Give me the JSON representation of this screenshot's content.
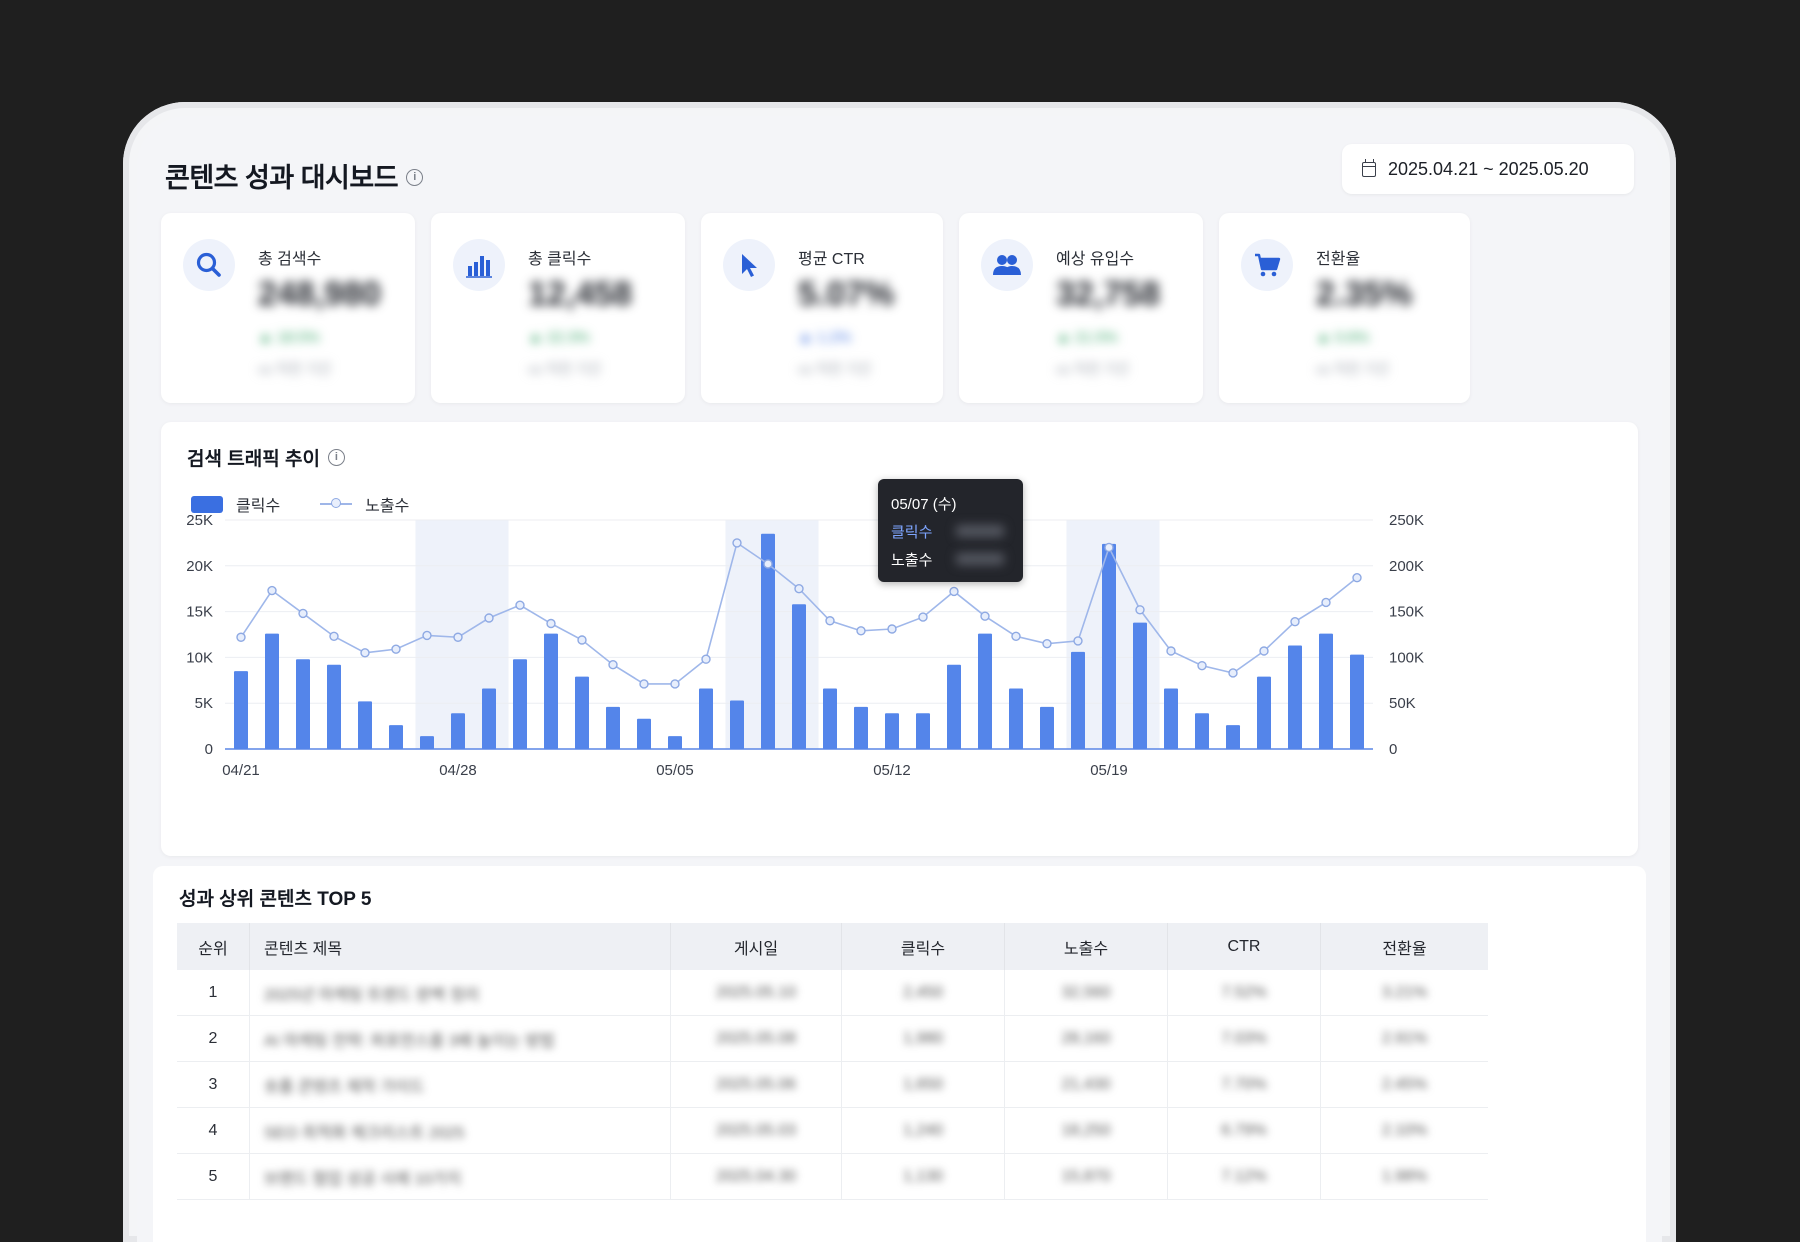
{
  "header": {
    "title": "콘텐츠 성과 대시보드",
    "date_range": "2025.04.21 ~ 2025.05.20"
  },
  "kpis": [
    {
      "label": "총 검색수",
      "icon": "search-icon",
      "value": "248,980",
      "delta": "▲ 18.5%",
      "sub": "vs 직전 기간"
    },
    {
      "label": "총 클릭수",
      "icon": "bar-chart-icon",
      "value": "12,458",
      "delta": "▲ 22.3%",
      "sub": "vs 직전 기간"
    },
    {
      "label": "평균 CTR",
      "icon": "cursor-icon",
      "value": "5.07%",
      "delta": "▲ 1.2%",
      "sub": "vs 직전 기간"
    },
    {
      "label": "예상 유입수",
      "icon": "users-icon",
      "value": "32,758",
      "delta": "▲ 21.5%",
      "sub": "vs 직전 기간"
    },
    {
      "label": "전환율",
      "icon": "cart-icon",
      "value": "2.35%",
      "delta": "▲ 0.6%",
      "sub": "vs 직전 기간"
    }
  ],
  "chart": {
    "title": "검색 트래픽 추이",
    "legend_bar": "클릭수",
    "legend_line": "노출수",
    "tooltip": {
      "date": "05/07 (수)",
      "row1": "클릭수",
      "row2": "노출수"
    }
  },
  "chart_data": {
    "type": "bar",
    "x": [
      "04/21",
      "04/22",
      "04/23",
      "04/24",
      "04/25",
      "04/26",
      "04/27",
      "04/28",
      "04/29",
      "04/30",
      "05/01",
      "05/02",
      "05/03",
      "05/04",
      "05/05",
      "05/06",
      "05/07",
      "05/08",
      "05/09",
      "05/10",
      "05/11",
      "05/12",
      "05/13",
      "05/14",
      "05/15",
      "05/16",
      "05/17",
      "05/18",
      "05/19",
      "05/20",
      "05/21",
      "05/22",
      "05/23",
      "05/24",
      "05/25",
      "05/26",
      "05/27"
    ],
    "x_tick_labels": [
      "04/21",
      "04/28",
      "05/05",
      "05/12",
      "05/19"
    ],
    "series": [
      {
        "name": "클릭수",
        "axis": "left",
        "values": [
          8500,
          12600,
          9800,
          9200,
          5200,
          2600,
          1400,
          3900,
          6600,
          9800,
          12600,
          7900,
          4600,
          3300,
          1400,
          6600,
          5300,
          23500,
          15800,
          6600,
          4600,
          3900,
          3900,
          9200,
          12600,
          6600,
          4600,
          10600,
          22400,
          13800,
          6600,
          3900,
          2600,
          7900,
          11300,
          12600,
          10300
        ]
      },
      {
        "name": "노출수",
        "axis": "right",
        "values": [
          122000,
          173000,
          148000,
          123000,
          105000,
          109000,
          124000,
          122000,
          143000,
          157000,
          137000,
          119000,
          92000,
          71000,
          71000,
          98000,
          225000,
          202000,
          175000,
          140000,
          129000,
          131000,
          144000,
          172000,
          145000,
          123000,
          115000,
          118000,
          220000,
          152000,
          107000,
          91000,
          83000,
          107000,
          139000,
          160000,
          187000
        ]
      }
    ],
    "ylim_left": [
      0,
      25000
    ],
    "ylim_right": [
      0,
      250000
    ],
    "y_ticks_left": [
      "25K",
      "20K",
      "15K",
      "10K",
      "5K",
      "0"
    ],
    "y_ticks_right": [
      "250K",
      "200K",
      "150K",
      "100K",
      "50K",
      "0"
    ],
    "grid": true
  },
  "table": {
    "title": "성과 상위 콘텐츠 TOP 5",
    "columns": [
      "순위",
      "콘텐츠 제목",
      "게시일",
      "클릭수",
      "노출수",
      "CTR",
      "전환율"
    ],
    "rows": [
      [
        "1",
        "2025년 마케팅 트렌드 완벽 정리",
        "2025.05.10",
        "2,450",
        "32,560",
        "7.52%",
        "3.21%"
      ],
      [
        "2",
        "AI 마케팅 전략: 퍼포먼스를 3배 높이는 방법",
        "2025.05.08",
        "1,980",
        "28,160",
        "7.03%",
        "2.91%"
      ],
      [
        "3",
        "숏폼 콘텐츠 제작 가이드",
        "2025.05.06",
        "1,650",
        "21,430",
        "7.70%",
        "2.45%"
      ],
      [
        "4",
        "SEO 최적화 체크리스트 2025",
        "2025.05.03",
        "1,240",
        "18,250",
        "6.79%",
        "2.10%"
      ],
      [
        "5",
        "브랜드 협업 성공 사례 10가지",
        "2025.04.30",
        "1,130",
        "15,870",
        "7.12%",
        "1.98%"
      ]
    ]
  }
}
